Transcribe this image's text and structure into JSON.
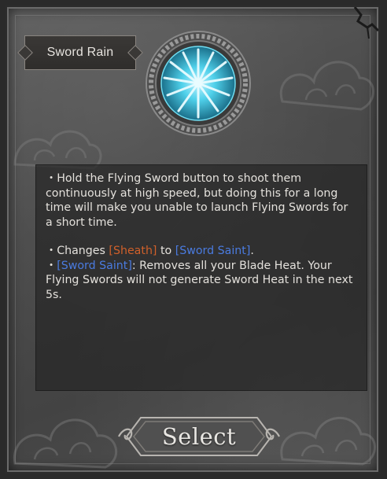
{
  "card": {
    "title": "Sword Rain",
    "emblem_icon": "sword-rain-icon"
  },
  "description": {
    "para1": "・Hold the Flying Sword button to shoot them continuously at high speed, but doing this for a long time will make you unable to launch Flying Swords for a short time.",
    "line2_prefix": "・Changes ",
    "line2_hl1": "[Sheath]",
    "line2_mid": " to ",
    "line2_hl2": "[Sword Saint]",
    "line2_suffix": ".",
    "line3_prefix": "・",
    "line3_hl": "[Sword Saint]",
    "line3_suffix": ": Removes all your Blade Heat. Your Flying Swords will not generate Sword Heat in the next 5s."
  },
  "colors": {
    "highlight_orange": "#d0602a",
    "highlight_blue": "#4a7be0",
    "emblem_cyan": "#3fc6e0"
  },
  "button": {
    "select_label": "Select"
  }
}
